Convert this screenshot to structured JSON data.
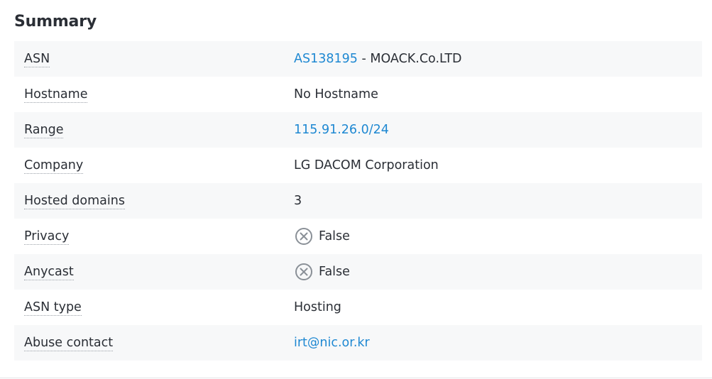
{
  "summary": {
    "title": "Summary",
    "rows": [
      {
        "label": "ASN",
        "value_link": "AS138195",
        "value_separator": " - ",
        "value_text": "MOACK.Co.LTD"
      },
      {
        "label": "Hostname",
        "value": "No Hostname"
      },
      {
        "label": "Range",
        "value_link": "115.91.26.0/24"
      },
      {
        "label": "Company",
        "value": "LG DACOM Corporation"
      },
      {
        "label": "Hosted domains",
        "value": "3"
      },
      {
        "label": "Privacy",
        "value": "False",
        "icon": "x-circle-icon"
      },
      {
        "label": "Anycast",
        "value": "False",
        "icon": "x-circle-icon"
      },
      {
        "label": "ASN type",
        "value": "Hosting"
      },
      {
        "label": "Abuse contact",
        "value_link": "irt@nic.or.kr"
      }
    ]
  },
  "colors": {
    "link": "#1e88d2",
    "row_shade": "#f7f8f9",
    "text": "#2a2e35",
    "icon": "#8a9097"
  }
}
